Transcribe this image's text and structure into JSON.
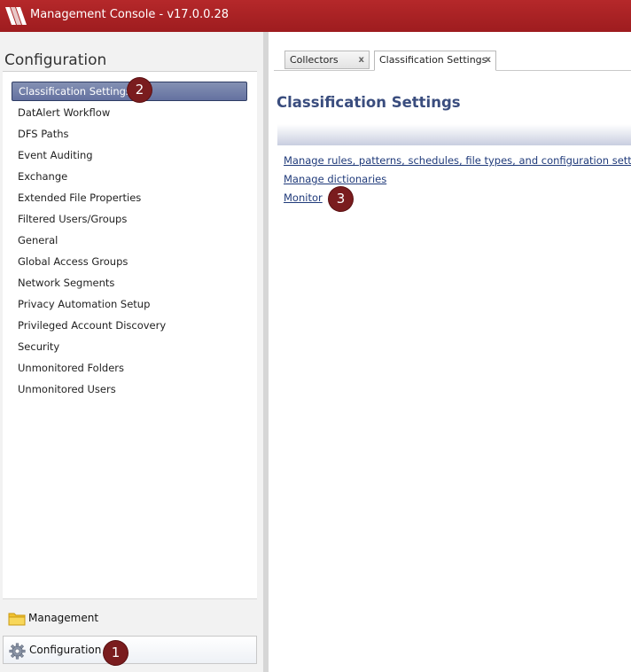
{
  "window": {
    "title": "Management Console - v17.0.0.28",
    "accent": "#a51f22"
  },
  "left_pane": {
    "heading": "Configuration",
    "items": [
      {
        "label": "Classification Settings",
        "selected": true
      },
      {
        "label": "DatAlert Workflow"
      },
      {
        "label": "DFS Paths"
      },
      {
        "label": "Event Auditing"
      },
      {
        "label": "Exchange"
      },
      {
        "label": "Extended File Properties"
      },
      {
        "label": "Filtered Users/Groups"
      },
      {
        "label": "General"
      },
      {
        "label": "Global Access Groups"
      },
      {
        "label": "Network Segments"
      },
      {
        "label": "Privacy Automation Setup"
      },
      {
        "label": "Privileged Account Discovery"
      },
      {
        "label": "Security"
      },
      {
        "label": "Unmonitored Folders"
      },
      {
        "label": "Unmonitored Users"
      }
    ],
    "bottom_nav": [
      {
        "label": "Management",
        "icon": "folder-icon"
      },
      {
        "label": "Configuration",
        "icon": "gear-icon",
        "active": true
      }
    ]
  },
  "tabs": [
    {
      "label": "Collectors",
      "close": "x"
    },
    {
      "label": "Classification Settings",
      "close": "x",
      "active": true
    }
  ],
  "content": {
    "title": "Classification Settings",
    "links": [
      "Manage rules, patterns, schedules, file types, and configuration settings",
      "Manage dictionaries",
      "Monitor"
    ]
  },
  "callouts": [
    "1",
    "2",
    "3"
  ]
}
